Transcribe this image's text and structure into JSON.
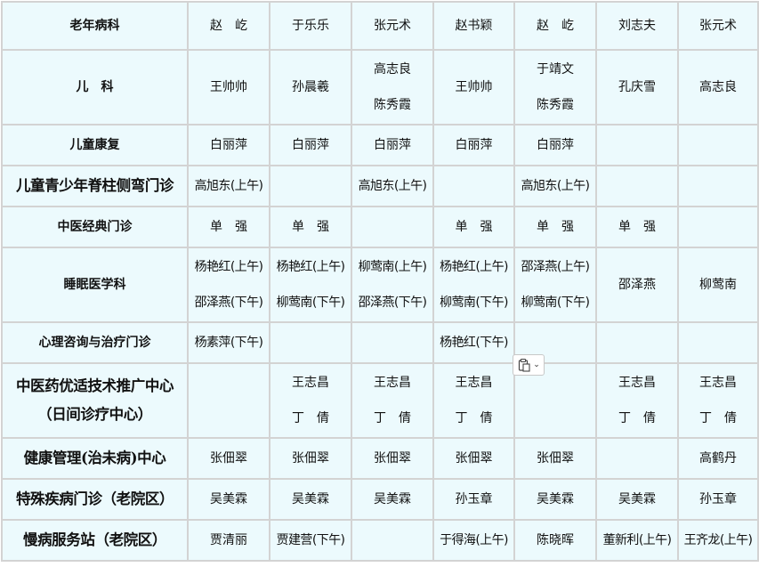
{
  "rows": [
    {
      "dept": [
        "老年病科"
      ],
      "cells": [
        [
          "赵　屹"
        ],
        [
          "于乐乐"
        ],
        [
          "张元术"
        ],
        [
          "赵书颖"
        ],
        [
          "赵　屹"
        ],
        [
          "刘志夫"
        ],
        [
          "张元术"
        ]
      ]
    },
    {
      "dept": [
        "儿　科"
      ],
      "cells": [
        [
          "王帅帅"
        ],
        [
          "孙晨羲"
        ],
        [
          "高志良",
          "陈秀霞"
        ],
        [
          "王帅帅"
        ],
        [
          "于靖文",
          "陈秀霞"
        ],
        [
          "孔庆雪"
        ],
        [
          "高志良"
        ]
      ]
    },
    {
      "dept": [
        "儿童康复"
      ],
      "cells": [
        [
          "白丽萍"
        ],
        [
          "白丽萍"
        ],
        [
          "白丽萍"
        ],
        [
          "白丽萍"
        ],
        [
          "白丽萍"
        ],
        [],
        []
      ]
    },
    {
      "dept": [
        "儿童青少年脊柱侧弯门诊"
      ],
      "cells": [
        [
          "高旭东(上午)"
        ],
        [],
        [
          "高旭东(上午)"
        ],
        [],
        [
          "高旭东(上午)"
        ],
        [],
        []
      ]
    },
    {
      "dept": [
        "中医经典门诊"
      ],
      "cells": [
        [
          "单　强"
        ],
        [
          "单　强"
        ],
        [],
        [
          "单　强"
        ],
        [
          "单　强"
        ],
        [
          "单　强"
        ],
        []
      ]
    },
    {
      "dept": [
        "睡眠医学科"
      ],
      "cells": [
        [
          "杨艳红(上午)",
          "邵泽燕(下午)"
        ],
        [
          "杨艳红(上午)",
          "柳莺南(下午)"
        ],
        [
          "柳莺南(上午)",
          "邵泽燕(下午)"
        ],
        [
          "杨艳红(上午)",
          "柳莺南(下午)"
        ],
        [
          "邵泽燕(上午)",
          "柳莺南(下午)"
        ],
        [
          "邵泽燕"
        ],
        [
          "柳莺南"
        ]
      ]
    },
    {
      "dept": [
        "心理咨询与治疗门诊"
      ],
      "cells": [
        [
          "杨素萍(下午)"
        ],
        [],
        [],
        [
          "杨艳红(下午)"
        ],
        [],
        [],
        []
      ]
    },
    {
      "dept": [
        "中医药优适技术推广中心",
        "（日间诊疗中心）"
      ],
      "cells": [
        [],
        [
          "王志昌",
          "丁　倩"
        ],
        [
          "王志昌",
          "丁　倩"
        ],
        [
          "王志昌",
          "丁　倩"
        ],
        [],
        [
          "王志昌",
          "丁　倩"
        ],
        [
          "王志昌",
          "丁　倩"
        ]
      ]
    },
    {
      "dept": [
        "健康管理(治未病)中心"
      ],
      "cells": [
        [
          "张佃翠"
        ],
        [
          "张佃翠"
        ],
        [
          "张佃翠"
        ],
        [
          "张佃翠"
        ],
        [
          "张佃翠"
        ],
        [],
        [
          "高鹤丹"
        ]
      ]
    },
    {
      "dept": [
        "特殊疾病门诊（老院区）"
      ],
      "cells": [
        [
          "吴美霖"
        ],
        [
          "吴美霖"
        ],
        [
          "吴美霖"
        ],
        [
          "孙玉章"
        ],
        [
          "吴美霖"
        ],
        [
          "吴美霖"
        ],
        [
          "孙玉章"
        ]
      ]
    },
    {
      "dept": [
        "慢病服务站（老院区）"
      ],
      "cells": [
        [
          "贾清丽"
        ],
        [
          "贾建营(下午)"
        ],
        [],
        [
          "于得海(上午)"
        ],
        [
          "陈晓晖"
        ],
        [
          "董新利(上午)"
        ],
        [
          "王齐龙(上午)"
        ]
      ]
    }
  ],
  "paste_widget": {
    "icon": "clipboard-icon",
    "caret": "chevron-down-icon"
  },
  "colors": {
    "cell_bg": "#ecfafd",
    "border": "#d3d3d3",
    "text": "#111111"
  }
}
